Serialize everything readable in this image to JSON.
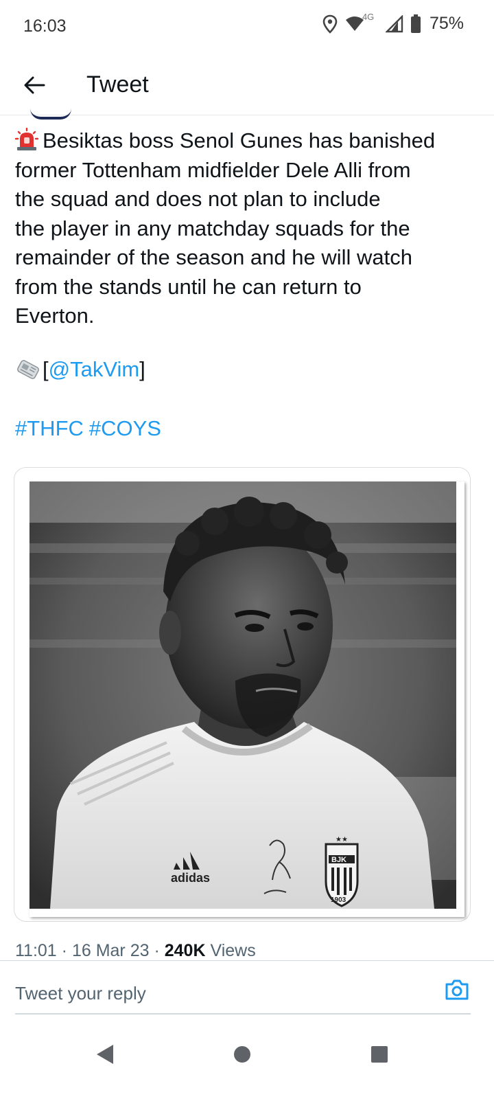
{
  "status_bar": {
    "time": "16:03",
    "network_label": "4G",
    "battery": "75%",
    "icons": [
      "location-icon",
      "wifi-icon",
      "cell-signal-icon",
      "battery-icon"
    ]
  },
  "header": {
    "title": "Tweet",
    "back_icon": "arrow-left-icon"
  },
  "tweet": {
    "lines": [
      "Besiktas boss Senol Gunes has banished",
      "former Tottenham midfielder Dele Alli from",
      "the squad and does not plan to include",
      "the player in any matchday squads for the",
      "remainder of the season and he will watch",
      "from the stands until he can return to",
      "Everton."
    ],
    "lead_emoji": "police-siren-emoji",
    "source_emoji": "newspaper-emoji",
    "source_open": "[",
    "source_handle": "@TakVim",
    "source_close": "]",
    "hashtags": [
      "#THFC",
      "#COYS"
    ],
    "media": {
      "kit_brand": "adidas",
      "badge_text": "BJK",
      "badge_year": "1903"
    },
    "meta": {
      "time": "11:01",
      "separator": "·",
      "date": "16 Mar 23",
      "views_count": "240K",
      "views_label": "Views"
    }
  },
  "reply": {
    "placeholder": "Tweet your reply",
    "camera_icon": "camera-icon"
  },
  "nav": {
    "icons": [
      "nav-back-icon",
      "nav-home-icon",
      "nav-recents-icon"
    ]
  },
  "colors": {
    "link": "#1d9bf0",
    "text": "#0f1419",
    "muted": "#536471",
    "border": "#cfd9de"
  }
}
